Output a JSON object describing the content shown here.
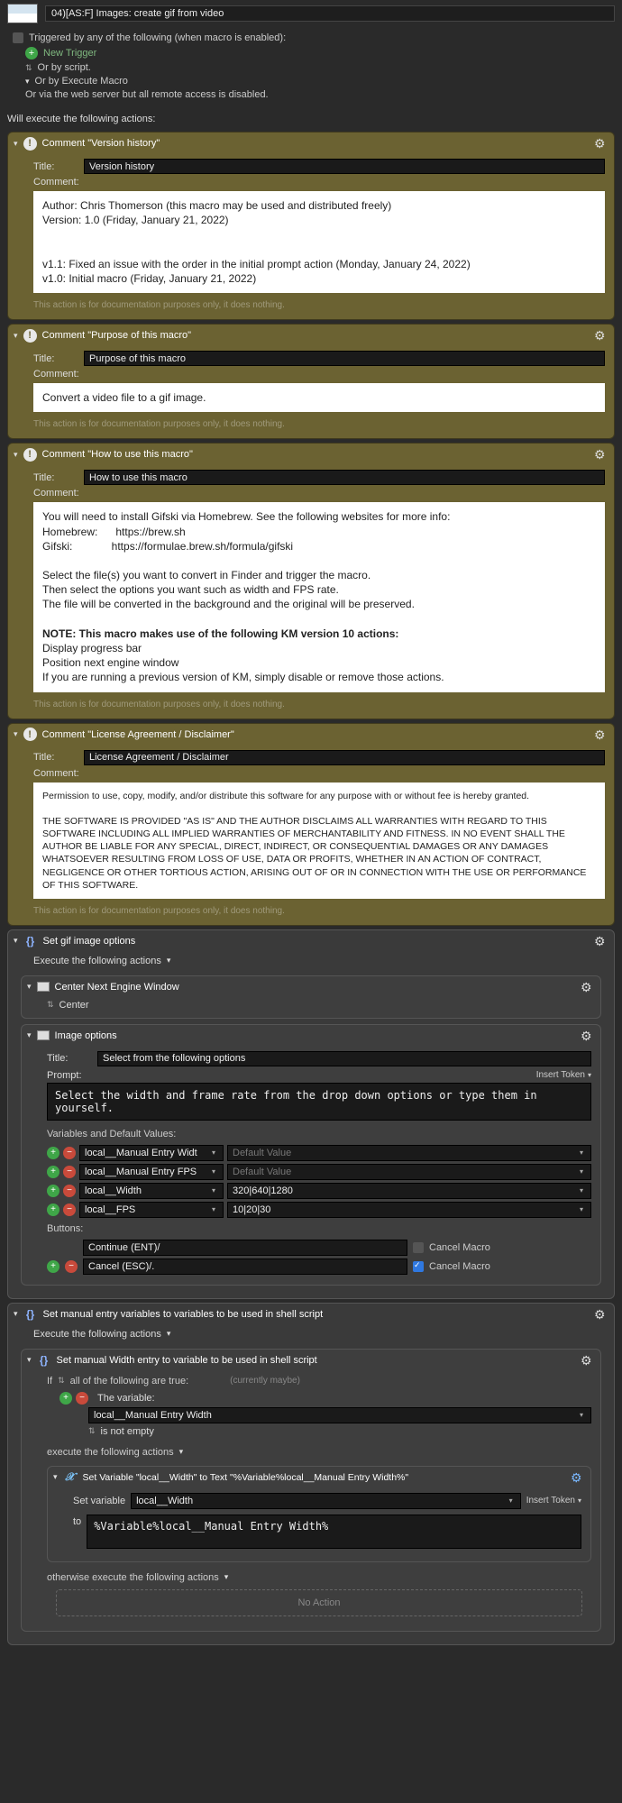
{
  "macro": {
    "title": "04)[AS:F] Images: create gif from video"
  },
  "triggers": {
    "heading": "Triggered by any of the following (when macro is enabled):",
    "new_trigger": "New Trigger",
    "or_script": "Or by script.",
    "or_execute": "Or by Execute Macro",
    "or_web": "Or via the web server but all remote access is disabled."
  },
  "will_execute": "Will execute the following actions:",
  "comments": [
    {
      "head": "Comment \"Version history\"",
      "title_label": "Title:",
      "title": "Version history",
      "comment_label": "Comment:",
      "body_lines": [
        "Author:        Chris Thomerson (this macro may be used and distributed freely)",
        "Version:       1.0 (Friday, January 21, 2022)",
        "",
        "v1.1:          Fixed an issue with the order in the initial prompt action (Monday, January 24, 2022)",
        "v1.0:          Initial macro (Friday, January 21, 2022)"
      ],
      "note": "This action is for documentation purposes only, it does nothing."
    },
    {
      "head": "Comment \"Purpose of this macro\"",
      "title_label": "Title:",
      "title": "Purpose of this macro",
      "comment_label": "Comment:",
      "body_plain": "Convert a video file to a gif image.",
      "note": "This action is for documentation purposes only, it does nothing."
    },
    {
      "head": "Comment \"How to use this macro\"",
      "title_label": "Title:",
      "title": "How to use this macro",
      "comment_label": "Comment:",
      "body_html": "You will need to install Gifski via Homebrew. See the following websites for more info:<br>Homebrew:&nbsp;&nbsp;&nbsp;&nbsp;&nbsp;&nbsp;https://brew.sh<br>Gifski:&nbsp;&nbsp;&nbsp;&nbsp;&nbsp;&nbsp;&nbsp;&nbsp;&nbsp;&nbsp;&nbsp;&nbsp;&nbsp;https://formulae.brew.sh/formula/gifski<br><br>Select the file(s) you want to convert in Finder and trigger the macro.<br>Then select the options you want such as width and FPS rate.<br>The file will be converted in the background and the original will be preserved.<br><br><b>NOTE: This macro makes use of the following KM version 10 actions:</b><br>Display progress bar<br>Position next engine window<br>If you are running a previous version of KM, simply disable or remove those actions.",
      "note": "This action is for documentation purposes only, it does nothing."
    },
    {
      "head": "Comment \"License Agreement / Disclaimer\"",
      "title_label": "Title:",
      "title": "License Agreement / Disclaimer",
      "comment_label": "Comment:",
      "body_html": "Permission to use, copy, modify, and/or distribute this software for any purpose with or without fee is hereby granted.<br><br>THE SOFTWARE IS PROVIDED \"AS IS\" AND THE AUTHOR DISCLAIMS ALL WARRANTIES WITH REGARD TO THIS SOFTWARE INCLUDING ALL IMPLIED WARRANTIES OF MERCHANTABILITY AND FITNESS. IN NO EVENT SHALL THE AUTHOR BE LIABLE FOR ANY SPECIAL, DIRECT, INDIRECT, OR CONSEQUENTIAL DAMAGES OR ANY DAMAGES WHATSOEVER RESULTING FROM LOSS OF USE, DATA OR PROFITS, WHETHER IN AN ACTION OF CONTRACT, NEGLIGENCE OR OTHER TORTIOUS ACTION, ARISING OUT OF OR IN CONNECTION WITH THE USE OR PERFORMANCE OF THIS SOFTWARE.",
      "note": "This action is for documentation purposes only, it does nothing.",
      "small": true
    }
  ],
  "group1": {
    "head": "Set gif image options",
    "exec": "Execute the following actions",
    "sub1": {
      "head": "Center Next Engine Window",
      "body": "Center"
    },
    "sub2": {
      "head": "Image options",
      "title_label": "Title:",
      "title": "Select from the following options",
      "prompt_label": "Prompt:",
      "insert_token": "Insert Token",
      "prompt_text": "Select the width and frame rate from the drop down options or type them in yourself.",
      "vars_label": "Variables and Default Values:",
      "vars": [
        {
          "name": "local__Manual Entry Widt",
          "val": "",
          "ph": "Default Value"
        },
        {
          "name": "local__Manual Entry FPS",
          "val": "",
          "ph": "Default Value"
        },
        {
          "name": "local__Width",
          "val": "320|640|1280",
          "ph": ""
        },
        {
          "name": "local__FPS",
          "val": "10|20|30",
          "ph": ""
        }
      ],
      "buttons_label": "Buttons:",
      "buttons": [
        {
          "text": "Continue (ENT)/",
          "cancel": false,
          "cancel_label": "Cancel Macro",
          "show_add": false
        },
        {
          "text": "Cancel (ESC)/.",
          "cancel": true,
          "cancel_label": "Cancel Macro",
          "show_add": true
        }
      ]
    }
  },
  "group2": {
    "head": "Set manual entry variables to variables to be used in shell script",
    "exec": "Execute the following actions",
    "ifblock": {
      "head": "Set manual Width entry to variable to be used in shell script",
      "if_label": "If",
      "all_of": "all of the following are true:",
      "currently": "(currently maybe)",
      "cond_label": "The variable:",
      "cond_var": "local__Manual Entry Width",
      "cond_op": "is not empty",
      "exec_label": "execute the following actions",
      "setvar": {
        "head": "Set Variable \"local__Width\" to Text \"%Variable%local__Manual Entry Width%\"",
        "setvar_label": "Set variable",
        "var": "local__Width",
        "insert_token": "Insert Token",
        "to_label": "to",
        "to_val": "%Variable%local__Manual Entry Width%"
      },
      "otherwise": "otherwise execute the following actions",
      "no_action": "No Action"
    }
  }
}
